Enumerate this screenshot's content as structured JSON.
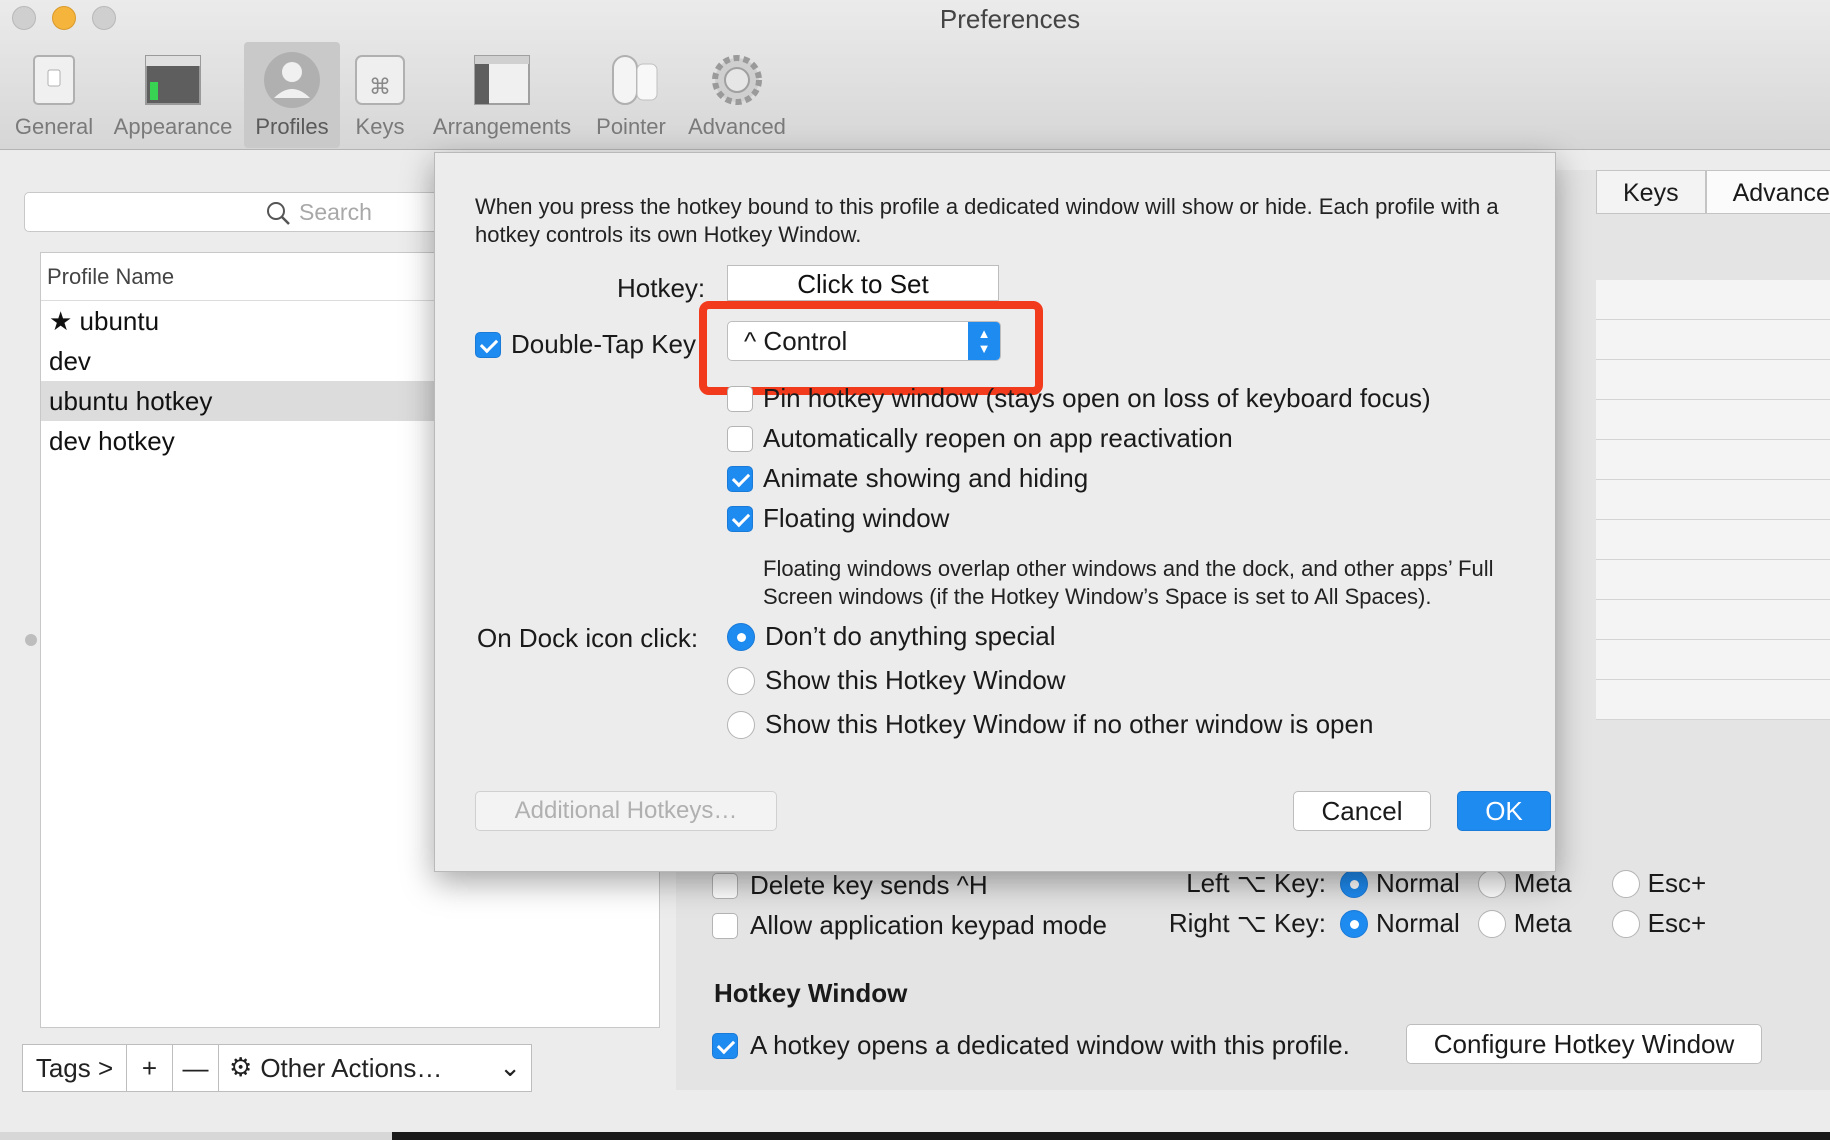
{
  "window": {
    "title": "Preferences"
  },
  "toolbar": {
    "items": [
      {
        "label": "General"
      },
      {
        "label": "Appearance"
      },
      {
        "label": "Profiles"
      },
      {
        "label": "Keys"
      },
      {
        "label": "Arrangements"
      },
      {
        "label": "Pointer"
      },
      {
        "label": "Advanced"
      }
    ],
    "active": "Profiles"
  },
  "sidebar": {
    "search_placeholder": "Search",
    "column_header": "Profile Name",
    "profiles": [
      {
        "name": "★ ubuntu"
      },
      {
        "name": "dev"
      },
      {
        "name": "ubuntu hotkey",
        "selected": true
      },
      {
        "name": "dev hotkey"
      }
    ],
    "bottom_bar": {
      "tags": "Tags >",
      "add": "+",
      "remove": "—",
      "other_actions": "Other Actions…",
      "chevron": "⌄"
    }
  },
  "right_pane": {
    "tabs": [
      "Keys",
      "Advanced"
    ],
    "delete_key_label": "Delete key sends ^H",
    "keypad_label": "Allow application keypad mode",
    "left_option_label": "Left ⌥ Key:",
    "right_option_label": "Right ⌥ Key:",
    "option_choices": [
      "Normal",
      "Meta",
      "Esc+"
    ],
    "hotkey_section_title": "Hotkey Window",
    "hotkey_checkbox_label": "A hotkey opens a dedicated window with this profile.",
    "configure_button": "Configure Hotkey Window"
  },
  "sheet": {
    "description": "When you press the hotkey bound to this profile a dedicated window will show or hide. Each profile with a hotkey controls its own Hotkey Window.",
    "hotkey_label": "Hotkey:",
    "hotkey_field": "Click to Set",
    "double_tap_label": "Double-Tap Key",
    "double_tap_value": "^ Control",
    "options": [
      {
        "label": "Pin hotkey window (stays open on loss of keyboard focus)",
        "checked": false
      },
      {
        "label": "Automatically reopen on app reactivation",
        "checked": false
      },
      {
        "label": "Animate showing and hiding",
        "checked": true
      },
      {
        "label": "Floating window",
        "checked": true
      }
    ],
    "floating_note": "Floating windows overlap other windows and the dock, and other apps’ Full Screen windows (if the Hotkey Window’s Space is set to All Spaces).",
    "dock_label": "On Dock icon click:",
    "dock_options": [
      {
        "label": "Don’t do anything special",
        "selected": true
      },
      {
        "label": "Show this Hotkey Window",
        "selected": false
      },
      {
        "label": "Show this Hotkey Window if no other window is open",
        "selected": false
      }
    ],
    "additional_hotkeys": "Additional Hotkeys…",
    "cancel": "Cancel",
    "ok": "OK"
  },
  "colors": {
    "accent": "#1e8bf0",
    "highlight": "#f23b1d"
  }
}
